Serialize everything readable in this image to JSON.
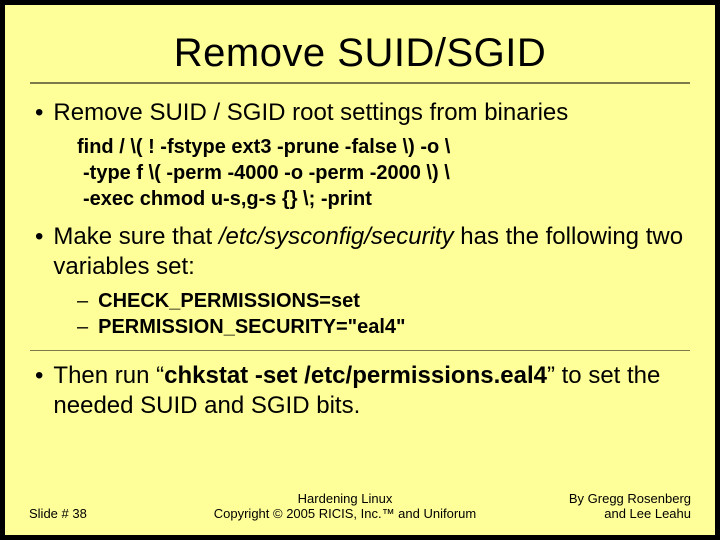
{
  "title": "Remove SUID/SGID",
  "bullets": {
    "b1": {
      "text": "Remove SUID / SGID root settings from binaries",
      "code_l1": "find / \\( ! -fstype ext3 -prune -false \\) -o \\",
      "code_l2": "-type f \\( -perm -4000 -o -perm -2000 \\) \\",
      "code_l3": "-exec chmod u-s,g-s {} \\; -print"
    },
    "b2": {
      "pre": "Make sure that ",
      "italic": "/etc/sysconfig/security",
      "post": " has the following two variables set:",
      "d1": "CHECK_PERMISSIONS=set",
      "d2": "PERMISSION_SECURITY=\"eal4\""
    },
    "b3": {
      "pre": "Then run “",
      "cmd": "chkstat -set /etc/permissions.eal4",
      "post": "” to set the needed SUID and SGID bits."
    }
  },
  "footer": {
    "slide_no": "Slide # 38",
    "center_l1": "Hardening Linux",
    "center_l2": "Copyright © 2005 RICIS, Inc.™ and Uniforum",
    "right_l1": "By Gregg Rosenberg",
    "right_l2": "and Lee Leahu"
  }
}
